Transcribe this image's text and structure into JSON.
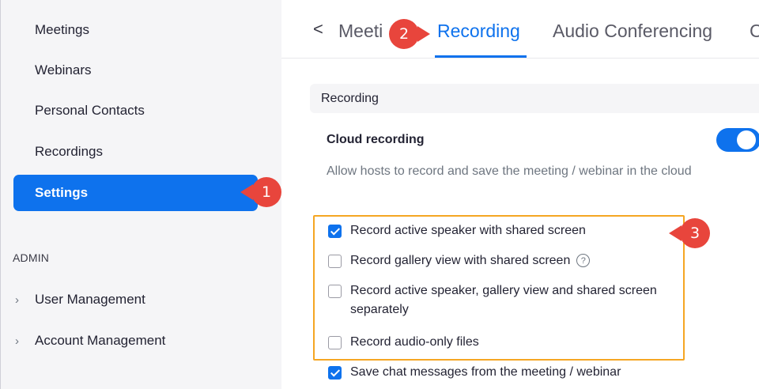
{
  "sidebar": {
    "items": [
      {
        "label": "Meetings",
        "active": false
      },
      {
        "label": "Webinars",
        "active": false
      },
      {
        "label": "Personal Contacts",
        "active": false
      },
      {
        "label": "Recordings",
        "active": false
      },
      {
        "label": "Settings",
        "active": true
      }
    ],
    "admin_label": "ADMIN",
    "admin_items": [
      {
        "label": "User Management",
        "expanded": false
      },
      {
        "label": "Account Management",
        "expanded": false
      }
    ]
  },
  "tabs": {
    "back_glyph": "<",
    "items": [
      {
        "label": "Meeti",
        "active": false
      },
      {
        "label": "Recording",
        "active": true
      },
      {
        "label": "Audio Conferencing",
        "active": false
      },
      {
        "label": "C",
        "active": false
      }
    ]
  },
  "section": {
    "title": "Recording"
  },
  "cloud_recording": {
    "title": "Cloud recording",
    "description": "Allow hosts to record and save the meeting / webinar in the cloud",
    "enabled": true
  },
  "options": [
    {
      "label": "Record active speaker with shared screen",
      "checked": true,
      "help": false
    },
    {
      "label": "Record gallery view with shared screen",
      "checked": false,
      "help": true
    },
    {
      "label": "Record active speaker, gallery view and shared screen separately",
      "checked": false,
      "help": false
    },
    {
      "label": "Record audio-only files",
      "checked": false,
      "help": false
    },
    {
      "label": "Save chat messages from the meeting / webinar",
      "checked": true,
      "help": false
    }
  ],
  "help_glyph": "?",
  "callouts": [
    "1",
    "2",
    "3"
  ],
  "colors": {
    "accent": "#0e72ed",
    "callout": "#e8453c",
    "highlight": "#f5a623"
  }
}
